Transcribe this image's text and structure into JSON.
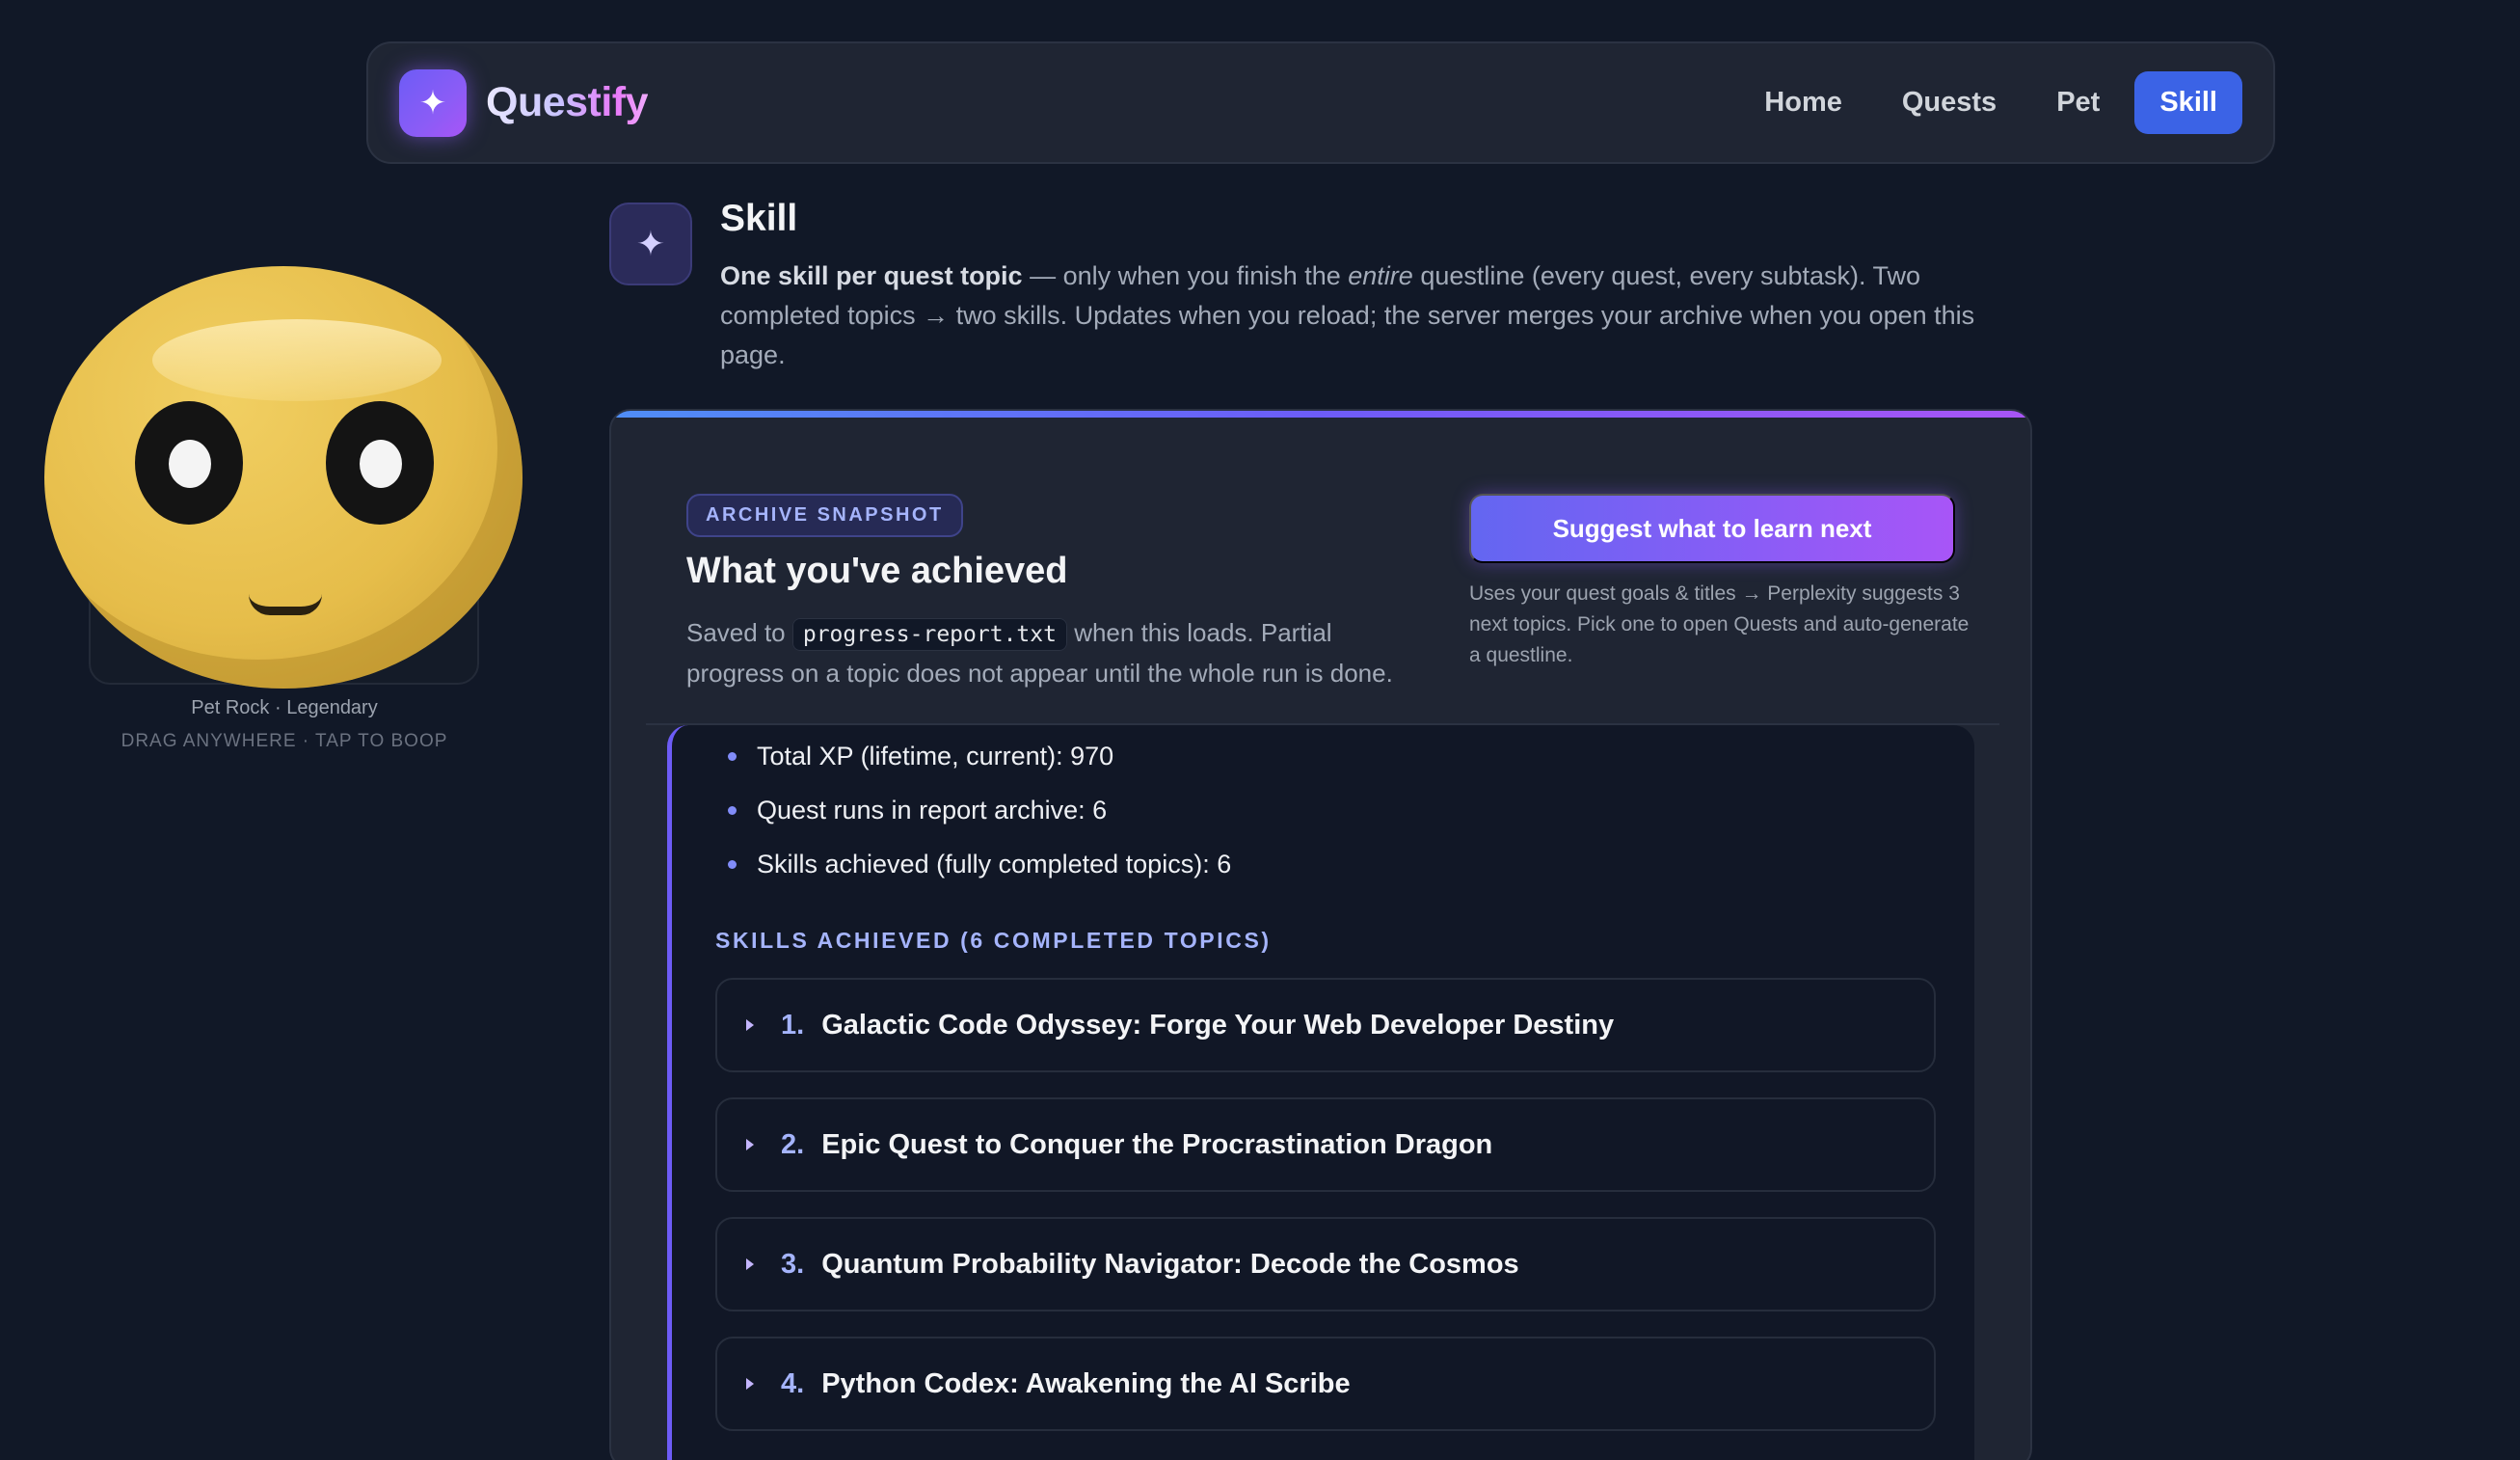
{
  "nav": {
    "logo_symbol": "✦",
    "brand": "Questify",
    "links": [
      {
        "label": "Home"
      },
      {
        "label": "Quests"
      },
      {
        "label": "Pet"
      },
      {
        "label": "Skill",
        "active": true
      }
    ]
  },
  "pet": {
    "caption": "Pet Rock · Legendary",
    "hint": "DRAG ANYWHERE · TAP TO BOOP"
  },
  "page": {
    "icon_symbol": "✦",
    "title": "Skill",
    "desc_bold": "One skill per quest topic",
    "desc_part1": " — only when you finish the ",
    "desc_em": "entire",
    "desc_part2": " questline (every quest, every subtask). Two completed topics → two skills. Updates when you reload; the server merges your archive when you open this page."
  },
  "card": {
    "badge": "ARCHIVE SNAPSHOT",
    "title": "What you've achieved",
    "desc_before": "Saved to ",
    "filename": "progress-report.txt",
    "desc_after": " when this loads. Partial progress on a topic does not appear until the whole run is done.",
    "suggest_button": "Suggest what to learn next",
    "suggest_note": "Uses your quest goals & titles → Perplexity suggests 3 next topics. Pick one to open Quests and auto-generate a questline."
  },
  "stats": [
    "Total XP (lifetime, current): 970",
    "Quest runs in report archive: 6",
    "Skills achieved (fully completed topics): 6"
  ],
  "skills_section_label": "SKILLS ACHIEVED (6 COMPLETED TOPICS)",
  "skills": [
    {
      "num": "1.",
      "title": "Galactic Code Odyssey: Forge Your Web Developer Destiny"
    },
    {
      "num": "2.",
      "title": "Epic Quest to Conquer the Procrastination Dragon"
    },
    {
      "num": "3.",
      "title": "Quantum Probability Navigator: Decode the Cosmos"
    },
    {
      "num": "4.",
      "title": "Python Codex: Awakening the AI Scribe"
    }
  ],
  "colors": {
    "background": "#111827",
    "accent": "#6d5cf6",
    "nav_active": "#3b63e6",
    "pet": "#e6bd4a"
  }
}
